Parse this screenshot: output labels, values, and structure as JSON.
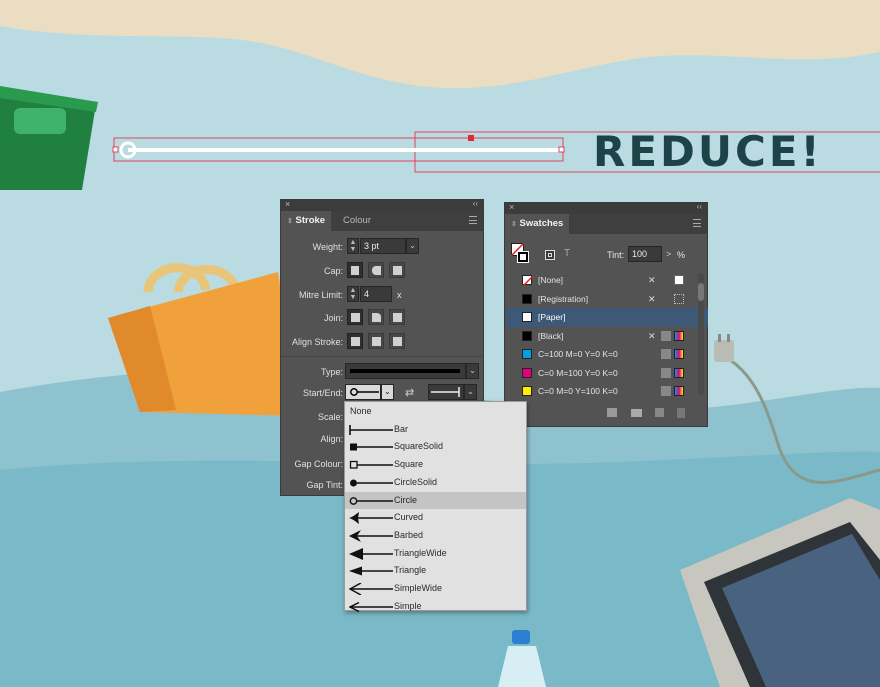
{
  "canvas": {
    "headline": "REDUCE!",
    "colors": {
      "sky": "#b9dbe1",
      "sand": "#ebddc1",
      "sea": "#8fc2cf",
      "deep_sea": "#6fb3c3",
      "text": "#1c4347"
    }
  },
  "stroke_panel": {
    "tabs": [
      "Stroke",
      "Colour"
    ],
    "weight_label": "Weight:",
    "weight_value": "3 pt",
    "cap_label": "Cap:",
    "mitre_label": "Mitre Limit:",
    "mitre_value": "4",
    "mitre_suffix": "x",
    "join_label": "Join:",
    "align_label": "Align Stroke:",
    "type_label": "Type:",
    "startend_label": "Start/End:",
    "scale_label": "Scale:",
    "align2_label": "Align:",
    "gap_colour_label": "Gap Colour:",
    "gap_tint_label": "Gap Tint:"
  },
  "arrowhead_dropdown": {
    "items": [
      {
        "label": "None",
        "icon": "none"
      },
      {
        "label": "Bar",
        "icon": "bar"
      },
      {
        "label": "SquareSolid",
        "icon": "square-solid"
      },
      {
        "label": "Square",
        "icon": "square"
      },
      {
        "label": "CircleSolid",
        "icon": "circle-solid"
      },
      {
        "label": "Circle",
        "icon": "circle"
      },
      {
        "label": "Curved",
        "icon": "curved"
      },
      {
        "label": "Barbed",
        "icon": "barbed"
      },
      {
        "label": "TriangleWide",
        "icon": "triangle-wide"
      },
      {
        "label": "Triangle",
        "icon": "triangle"
      },
      {
        "label": "SimpleWide",
        "icon": "simple-wide"
      },
      {
        "label": "Simple",
        "icon": "simple"
      }
    ],
    "highlighted": "Circle"
  },
  "swatches_panel": {
    "tab": "Swatches",
    "tint_label": "Tint:",
    "tint_value": "100",
    "tint_unit": "%",
    "swatches": [
      {
        "name": "[None]",
        "color": "none"
      },
      {
        "name": "[Registration]",
        "color": "#000000"
      },
      {
        "name": "[Paper]",
        "color": "#ffffff"
      },
      {
        "name": "[Black]",
        "color": "#000000"
      },
      {
        "name": "C=100 M=0 Y=0 K=0",
        "color": "#00a0e3"
      },
      {
        "name": "C=0 M=100 Y=0 K=0",
        "color": "#e5007e"
      },
      {
        "name": "C=0 M=0 Y=100 K=0",
        "color": "#ffed00"
      }
    ],
    "selected": "[Paper]"
  }
}
